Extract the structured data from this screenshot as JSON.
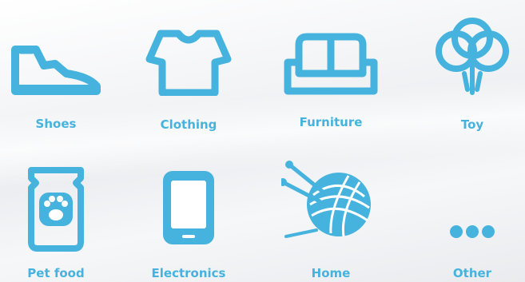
{
  "accent_color": "#45b3dd",
  "categories": [
    {
      "label": "Shoes",
      "icon": "shoe-icon"
    },
    {
      "label": "Clothing",
      "icon": "tshirt-icon"
    },
    {
      "label": "Furniture",
      "icon": "sofa-icon"
    },
    {
      "label": "Toy",
      "icon": "balloons-icon"
    },
    {
      "label": "Pet food",
      "icon": "pet-food-bag-icon"
    },
    {
      "label": "Electronics",
      "icon": "smartphone-icon"
    },
    {
      "label": "Home",
      "icon": "yarn-ball-icon"
    },
    {
      "label": "Other",
      "icon": "more-dots-icon"
    }
  ]
}
